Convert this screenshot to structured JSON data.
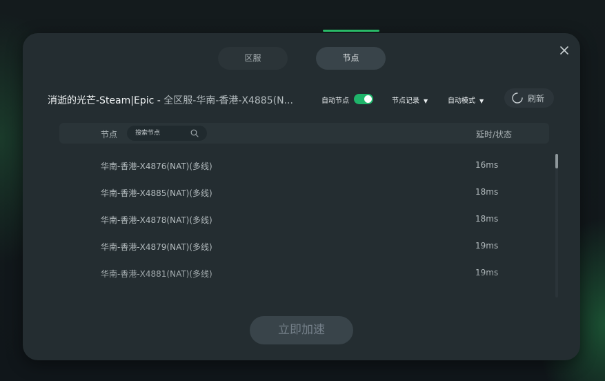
{
  "tabs": {
    "region_label": "区服",
    "node_label": "节点"
  },
  "header": {
    "game_name": "消逝的光芒-Steam|Epic",
    "separator": " - ",
    "node_path": "全区服-华南-香港-X4885(N..."
  },
  "controls": {
    "auto_node_label": "自动节点",
    "auto_node_on": true,
    "node_record_label": "节点记录",
    "auto_mode_label": "自动模式",
    "refresh_label": "刷新"
  },
  "table": {
    "node_header": "节点",
    "search_placeholder": "搜索节点",
    "latency_header": "延时/状态",
    "rows": [
      {
        "name": "华南-香港-X4876(NAT)(多线)",
        "latency": "16ms"
      },
      {
        "name": "华南-香港-X4885(NAT)(多线)",
        "latency": "18ms"
      },
      {
        "name": "华南-香港-X4878(NAT)(多线)",
        "latency": "18ms"
      },
      {
        "name": "华南-香港-X4879(NAT)(多线)",
        "latency": "19ms"
      },
      {
        "name": "华南-香港-X4881(NAT)(多线)",
        "latency": "19ms"
      }
    ]
  },
  "footer": {
    "accelerate_label": "立即加速"
  },
  "colors": {
    "accent": "#2ecc71",
    "toggle_on": "#1fb46a",
    "modal_bg": "#242d31"
  }
}
